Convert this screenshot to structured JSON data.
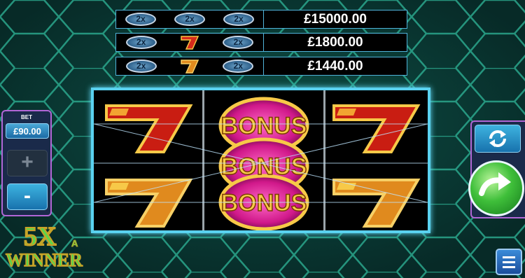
{
  "paytable": [
    {
      "symbols": [
        "2x",
        "2x",
        "2x"
      ],
      "amount": "£15000.00"
    },
    {
      "symbols": [
        "2x",
        "7",
        "2x"
      ],
      "amount": "£1800.00"
    },
    {
      "symbols": [
        "2x",
        "7",
        "2x"
      ],
      "amount": "£1440.00"
    }
  ],
  "bet": {
    "label": "BET",
    "value": "£90.00",
    "plus": "+",
    "minus": "-"
  },
  "reels": {
    "left": [
      "seven-icon",
      "blank",
      "seven-icon"
    ],
    "middle": [
      "BONUS",
      "BONUS",
      "BONUS"
    ],
    "right": [
      "seven-icon",
      "blank",
      "seven-icon"
    ]
  },
  "logo": {
    "main": "5X",
    "sub": "WINNER",
    "a": "A"
  },
  "colors": {
    "accent_cyan": "#5ad2f0",
    "panel_purple": "#b166d6",
    "spin_green": "#3fbf3a"
  }
}
